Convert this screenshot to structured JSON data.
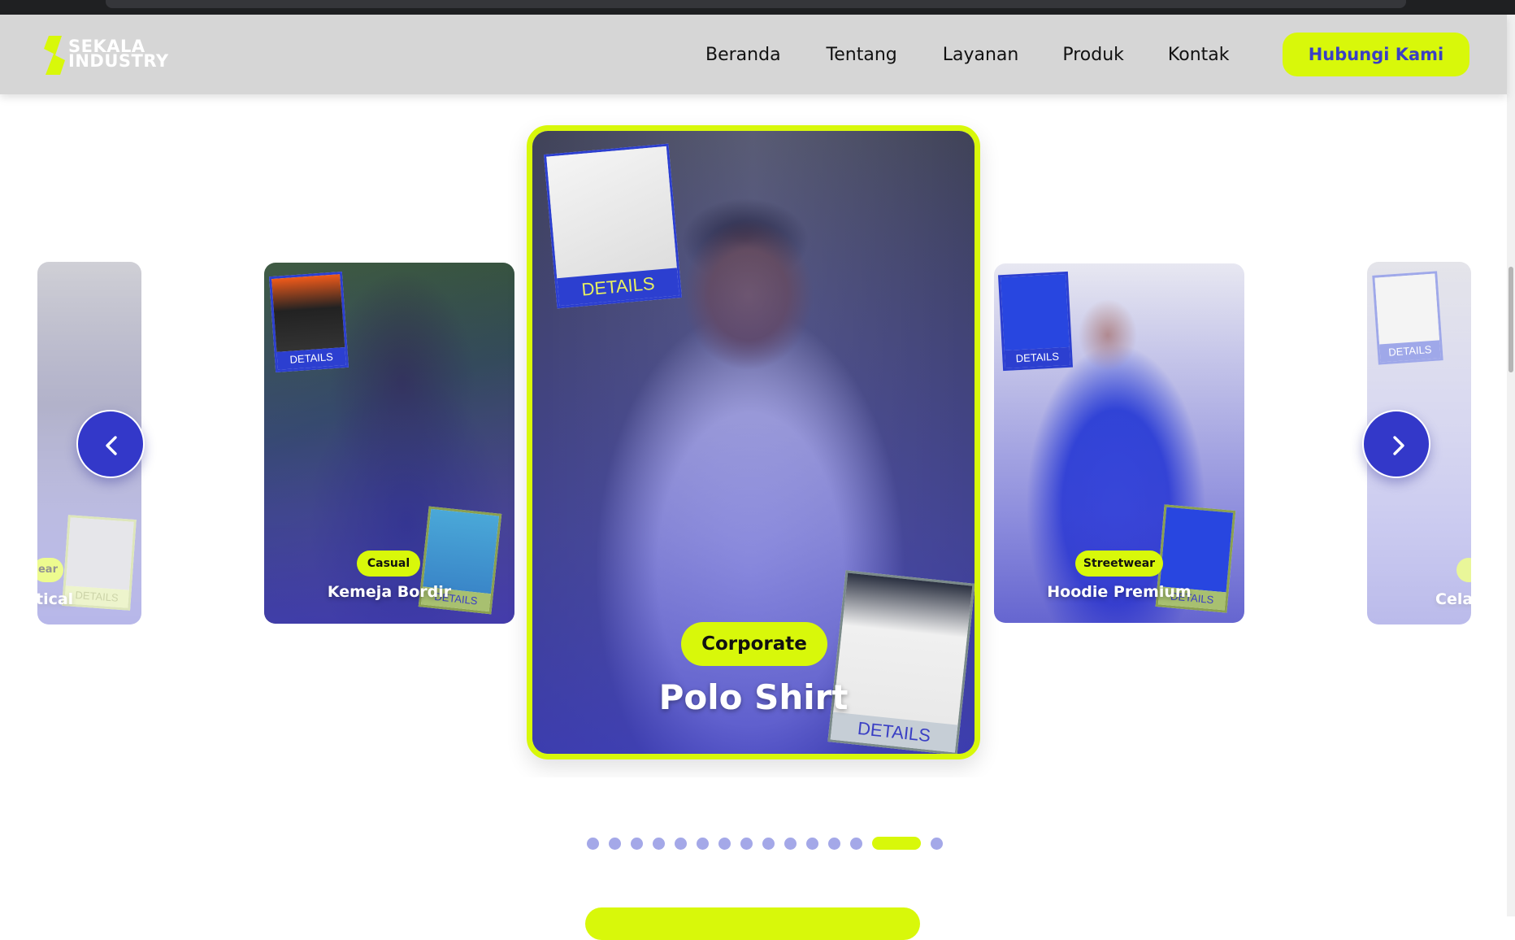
{
  "browser": {
    "address": ""
  },
  "header": {
    "logo_line1": "SEKALA",
    "logo_line2": "INDUSTRY",
    "nav": [
      "Beranda",
      "Tentang",
      "Layanan",
      "Produk",
      "Kontak"
    ],
    "cta_label": "Hubungi Kami"
  },
  "carousel": {
    "details_label": "DETAILS",
    "cards": [
      {
        "category": "ear",
        "title": "tical"
      },
      {
        "category": "Casual",
        "title": "Kemeja Bordir"
      },
      {
        "category": "Corporate",
        "title": "Polo Shirt"
      },
      {
        "category": "Streetwear",
        "title": "Hoodie Premium"
      },
      {
        "category": "",
        "title": "Cela"
      }
    ],
    "prev_icon": "chevron-left-icon",
    "next_icon": "chevron-right-icon",
    "dot_count": 15,
    "active_dot_index": 13
  },
  "colors": {
    "accent": "#d8f80a",
    "brand_blue": "#3338c9",
    "dot_inactive": "#a4a8e8"
  }
}
